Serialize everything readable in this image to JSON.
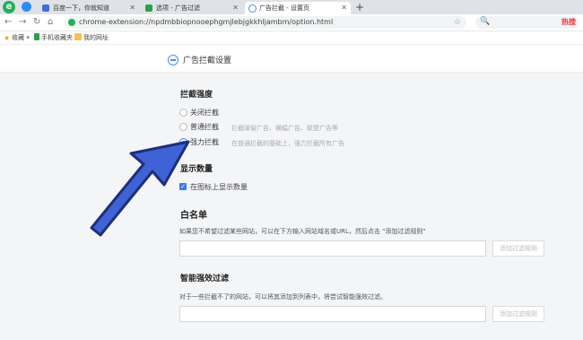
{
  "browser": {
    "logo_glyph": "e",
    "tabs": [
      {
        "label": "百度一下，你就知道",
        "close": "✕"
      },
      {
        "label": "选项 - 广告过滤",
        "close": "✕"
      },
      {
        "label": "广告拦截 - 设置页",
        "close": "✕"
      }
    ],
    "new_tab": "+",
    "nav": {
      "back": "←",
      "forward": "→",
      "reload": "↻",
      "home": "⌂"
    },
    "url": "chrome-extension://npdmbbiopnooephgmjlebjgkkhljambm/option.html",
    "url_star": "☆",
    "search_icon_glyph": "🔍",
    "hot_search": "热搜",
    "bookmarks": [
      "收藏",
      "手机收藏夹",
      "我的网址"
    ],
    "bookmark_dropdown": "▾"
  },
  "page": {
    "title": "广告拦截设置",
    "intensity": {
      "heading": "拦截强度",
      "options": [
        {
          "label": "关闭拦截",
          "desc": "",
          "selected": false
        },
        {
          "label": "普通拦截",
          "desc": "拦截弹窗广告、横幅广告、联盟广告等",
          "selected": false
        },
        {
          "label": "强力拦截",
          "desc": "在普通拦截的基础上，强力拦截所有广告",
          "selected": true
        }
      ]
    },
    "display": {
      "heading": "显示数量",
      "checkbox_label": "在图标上显示数量",
      "checked": true,
      "check_glyph": "✓"
    },
    "whitelist": {
      "heading": "白名单",
      "note": "如果您不希望过滤某些网站，可以在下方输入网站域名或URL，然后点击 \"添加过滤规则\"",
      "button": "添加过滤规则"
    },
    "smart": {
      "heading": "智能强效过滤",
      "note": "对于一些拦截不了的网站，可以将其添加到列表中，将尝试智能强效过滤。",
      "button": "添加过滤规则"
    }
  },
  "colors": {
    "accent": "#3d7de6",
    "arrow": "#3f63d6",
    "arrow_outline": "#1e2f7a"
  }
}
